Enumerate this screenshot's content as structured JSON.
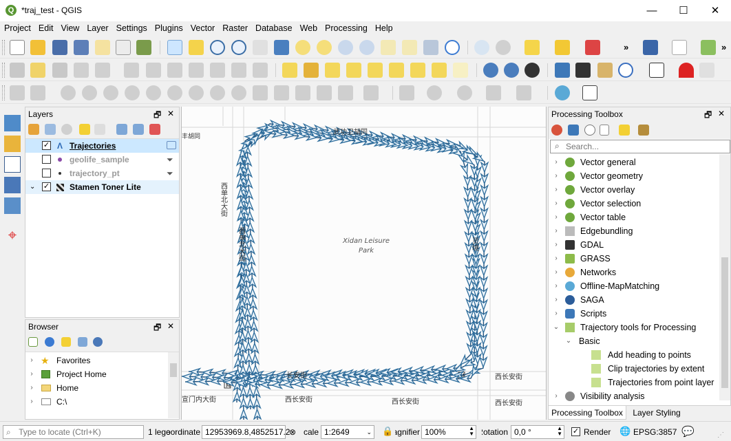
{
  "window": {
    "title": "*traj_test - QGIS",
    "minimize": "—",
    "maximize": "☐",
    "close": "✕"
  },
  "menu": [
    "Project",
    "Edit",
    "View",
    "Layer",
    "Settings",
    "Plugins",
    "Vector",
    "Raster",
    "Database",
    "Web",
    "Processing",
    "Help"
  ],
  "toolbar": {
    "more": "»"
  },
  "layers_panel": {
    "title": "Layers",
    "items": [
      {
        "label": "Trajectories",
        "checked": true
      },
      {
        "label": "geolife_sample",
        "checked": false
      },
      {
        "label": "trajectory_pt",
        "checked": false
      },
      {
        "label": "Stamen Toner Lite",
        "checked": true
      }
    ]
  },
  "browser_panel": {
    "title": "Browser",
    "items": [
      "Favorites",
      "Project Home",
      "Home",
      "C:\\"
    ]
  },
  "map": {
    "park_name": "Xidan Leisure Park",
    "street_labels": [
      "武功卫胡同",
      "西单北大街",
      "西单北大街",
      "西长安街",
      "西长安街",
      "西长安街",
      "西长安街",
      "宣门内大街",
      "长安街",
      "灵境",
      "丰胡同"
    ]
  },
  "toolbox": {
    "title": "Processing Toolbox",
    "search_placeholder": "Search...",
    "items": [
      "Vector general",
      "Vector geometry",
      "Vector overlay",
      "Vector selection",
      "Vector table",
      "Edgebundling",
      "GDAL",
      "GRASS",
      "Networks",
      "Offline-MapMatching",
      "SAGA",
      "Scripts",
      "Trajectory tools for Processing"
    ],
    "subgroup": "Basic",
    "algorithms": [
      "Add heading to points",
      "Clip trajectories by extent",
      "Trajectories from point layer"
    ],
    "last_item": "Visibility analysis",
    "tabs": [
      "Processing Toolbox",
      "Layer Styling"
    ]
  },
  "statusbar": {
    "locate_placeholder": "Type to locate (Ctrl+K)",
    "legend": "1 lege",
    "coord_label": "Coordinate",
    "coordinate": "12953969.8,4852517.2",
    "scale_label": "Scale",
    "scale": "1:2649",
    "magnifier_label": "Magnifier",
    "magnifier": "100%",
    "rotation_label": "Rotation",
    "rotation": "0,0 °",
    "render": "Render",
    "crs": "EPSG:3857"
  },
  "colors": {
    "selection": "#cce8ff",
    "qgis_green": "#589632",
    "trajectory": "#2e6d9c"
  }
}
